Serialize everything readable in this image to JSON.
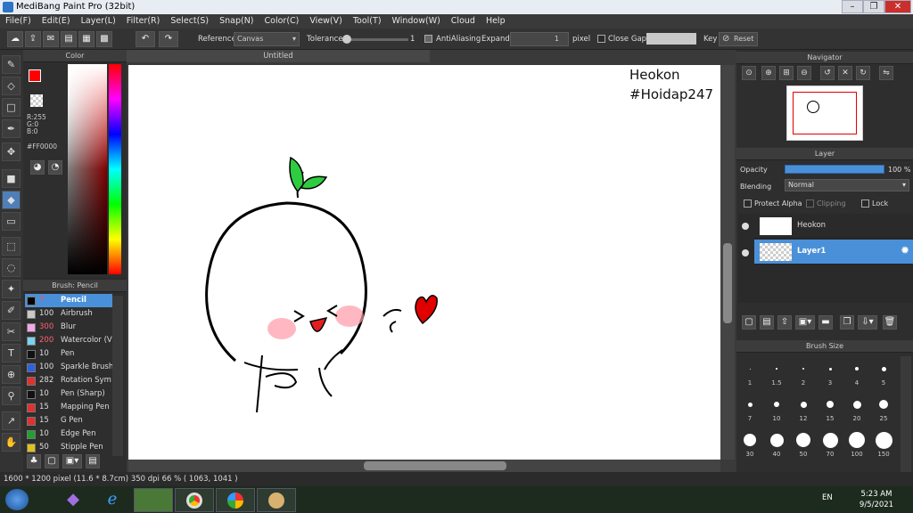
{
  "window": {
    "title": "MediBang Paint Pro (32bit)"
  },
  "menu": [
    "File(F)",
    "Edit(E)",
    "Layer(L)",
    "Filter(R)",
    "Select(S)",
    "Snap(N)",
    "Color(C)",
    "View(V)",
    "Tool(T)",
    "Window(W)",
    "Cloud",
    "Help"
  ],
  "toolbar": {
    "reference_label": "Reference",
    "reference_value": "Canvas",
    "tolerance_label": "Tolerance",
    "tolerance_value": "1",
    "antialias_label": "AntiAliasing",
    "expand_label": "Expand",
    "expand_value": "1",
    "expand_unit": "pixel",
    "close_gaps_label": "Close Gaps",
    "key_label": "Key",
    "reset_label": "Reset"
  },
  "color_panel": {
    "title": "Color",
    "r": "R:255",
    "g": "G:0",
    "b": "B:0",
    "hex": "#FF0000",
    "fg_color": "#ff0000"
  },
  "brush_panel": {
    "title": "Brush: Pencil",
    "items": [
      {
        "size": "7",
        "name": "Pencil",
        "color": "#000000",
        "selected": true
      },
      {
        "size": "100",
        "name": "Airbrush",
        "color": "#c8c8c8"
      },
      {
        "size": "300",
        "name": "Blur",
        "color": "#f4a6e8"
      },
      {
        "size": "200",
        "name": "Watercolor (V",
        "color": "#7ad4f0"
      },
      {
        "size": "10",
        "name": "Pen",
        "color": "#111111"
      },
      {
        "size": "100",
        "name": "Sparkle Brush",
        "color": "#3060e0"
      },
      {
        "size": "282",
        "name": "Rotation Sym",
        "color": "#e03030"
      },
      {
        "size": "10",
        "name": "Pen (Sharp)",
        "color": "#111111"
      },
      {
        "size": "15",
        "name": "Mapping Pen",
        "color": "#e03030"
      },
      {
        "size": "15",
        "name": "G Pen",
        "color": "#e03030"
      },
      {
        "size": "10",
        "name": "Edge Pen",
        "color": "#20a030"
      },
      {
        "size": "50",
        "name": "Stipple Pen",
        "color": "#e0c020"
      }
    ]
  },
  "document": {
    "tab": "Untitled",
    "text_line1": "Heokon",
    "text_line2": "#Hoidap247"
  },
  "navigator": {
    "title": "Navigator"
  },
  "layer_panel": {
    "title": "Layer",
    "opacity_label": "Opacity",
    "opacity_value": "100 %",
    "blending_label": "Blending",
    "blending_value": "Normal",
    "protect_alpha_label": "Protect Alpha",
    "clipping_label": "Clipping",
    "lock_label": "Lock",
    "layers": [
      {
        "name": "Heokon",
        "selected": false
      },
      {
        "name": "Layer1",
        "selected": true
      }
    ]
  },
  "brush_size": {
    "title": "Brush Size",
    "sizes": [
      "1",
      "1.5",
      "2",
      "3",
      "4",
      "5",
      "7",
      "10",
      "12",
      "15",
      "20",
      "25",
      "30",
      "40",
      "50",
      "70",
      "100",
      "150"
    ]
  },
  "status": {
    "text": "1600 * 1200 pixel   (11.6 * 8.7cm)   350 dpi   66 %   ( 1063, 1041 )"
  },
  "taskbar": {
    "lang": "EN",
    "time": "5:23 AM",
    "date": "9/5/2021"
  }
}
